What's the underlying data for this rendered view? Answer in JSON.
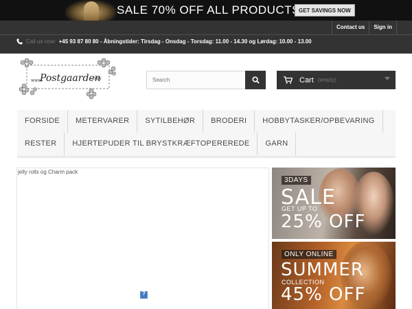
{
  "promo": {
    "headline": "SALE 70% OFF ALL PRODUCTS",
    "button": "GET SAVINGS NOW"
  },
  "nav_top": {
    "links": [
      "Contact us",
      "Sign in"
    ]
  },
  "contact": {
    "label": "Call us now:",
    "info": "+45 93 87 80 80 - Åbningstider: Tirsdag - Onsdag - Torsdag: 11.00 - 14.30 og Lørdag: 10.00 - 13.00",
    "icon": "phone-icon"
  },
  "logo": {
    "prefix": "www.",
    "name": "Postgaarden",
    "suffix": ".com"
  },
  "search": {
    "placeholder": "Search",
    "icon": "search-icon"
  },
  "cart": {
    "label": "Cart",
    "status": "(empty)",
    "icon": "cart-icon"
  },
  "menu": {
    "row1": [
      "FORSIDE",
      "METERVARER",
      "SYTILBEHØR",
      "BRODERI",
      "HOBBYTASKER/OPBEVARING"
    ],
    "row2": [
      "RESTER",
      "HJERTEPUDER TIL BRYSTKRÆFTOPEREREDE",
      "GARN"
    ]
  },
  "content": {
    "title": "jelly rolls og Charm pack"
  },
  "banners": [
    {
      "tag": "3DAYS",
      "big": "SALE",
      "mid": "GET UP TO",
      "big2": "25% OFF"
    },
    {
      "tag": "ONLY ONLINE",
      "big": "SUMMER",
      "mid": "COLLECTION",
      "big2": "45% OFF"
    }
  ],
  "colors": {
    "dark": "#333333",
    "promo_bg": "#111111",
    "menu_bg": "#f6f6f6"
  }
}
